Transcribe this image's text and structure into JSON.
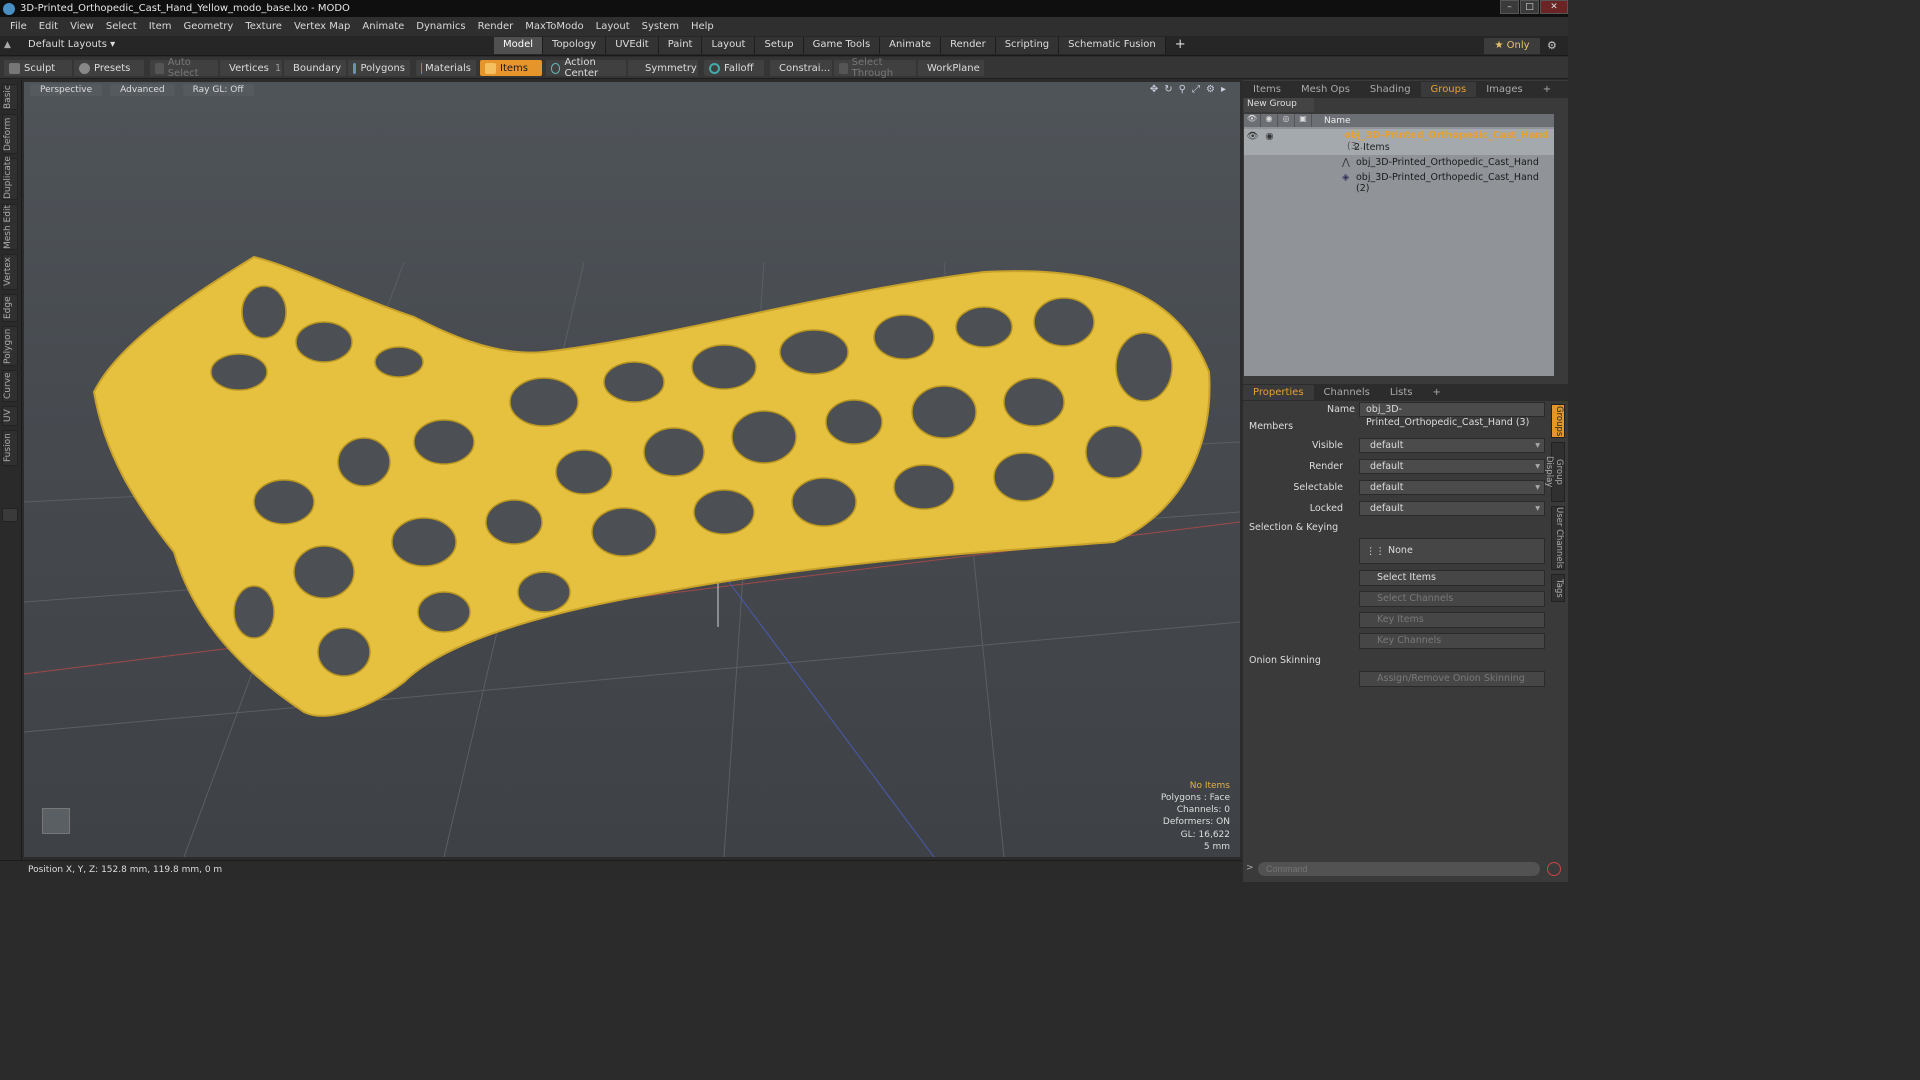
{
  "window": {
    "title": "3D-Printed_Orthopedic_Cast_Hand_Yellow_modo_base.lxo - MODO"
  },
  "menu": [
    "File",
    "Edit",
    "View",
    "Select",
    "Item",
    "Geometry",
    "Texture",
    "Vertex Map",
    "Animate",
    "Dynamics",
    "Render",
    "MaxToModo",
    "Layout",
    "System",
    "Help"
  ],
  "layout": {
    "default_layouts": "Default Layouts ▾",
    "tabs": [
      "Model",
      "Topology",
      "UVEdit",
      "Paint",
      "Layout",
      "Setup",
      "Game Tools",
      "Animate",
      "Render",
      "Scripting",
      "Schematic Fusion"
    ],
    "active_tab": "Model",
    "plus": "+",
    "only": "★ Only"
  },
  "toolbar": {
    "sculpt": "Sculpt",
    "presets": "Presets",
    "auto_select": "Auto Select",
    "vertices": "Vertices",
    "vertices_count": "1",
    "boundary": "Boundary",
    "polygons": "Polygons",
    "materials": "Materials",
    "items": "Items",
    "action_center": "Action Center",
    "symmetry": "Symmetry",
    "falloff": "Falloff",
    "constrain": "Constrai...",
    "select_through": "Select Through",
    "workplane": "WorkPlane"
  },
  "left_tabs": [
    "Basic",
    "Deform",
    "Duplicate",
    "Mesh Edit",
    "Vertex",
    "Edge",
    "Polygon",
    "Curve",
    "UV",
    "Fusion"
  ],
  "viewport": {
    "perspective": "Perspective",
    "advanced": "Advanced",
    "raygl": "Ray GL: Off",
    "info": {
      "no_items": "No Items",
      "polygons": "Polygons : Face",
      "channels": "Channels: 0",
      "deformers": "Deformers: ON",
      "gl": "GL: 16,622",
      "scale": "5 mm"
    },
    "colors": {
      "model": "#e6c140",
      "bg_top": "#4f5459",
      "bg_bottom": "#3e4246"
    }
  },
  "status": {
    "position": "Position X, Y, Z:  152.8 mm, 119.8 mm, 0 m"
  },
  "groups_panel": {
    "tabs": [
      "Items",
      "Mesh Ops",
      "Shading",
      "Groups",
      "Images",
      "+"
    ],
    "active_tab": "Groups",
    "new_group": "New Group",
    "name_header": "Name",
    "group_name": "obj_3D-Printed_Orthopedic_Cast_Hand",
    "group_suffix": "(3...",
    "group_count": "2 Items",
    "children": [
      "obj_3D-Printed_Orthopedic_Cast_Hand",
      "obj_3D-Printed_Orthopedic_Cast_Hand (2)"
    ]
  },
  "properties": {
    "tabs": [
      "Properties",
      "Channels",
      "Lists",
      "+"
    ],
    "active_tab": "Properties",
    "name_label": "Name",
    "name_value": "obj_3D-Printed_Orthopedic_Cast_Hand (3)",
    "members": "Members",
    "visible_label": "Visible",
    "visible_value": "default",
    "render_label": "Render",
    "render_value": "default",
    "selectable_label": "Selectable",
    "selectable_value": "default",
    "locked_label": "Locked",
    "locked_value": "default",
    "selection_keying": "Selection & Keying",
    "none": "None",
    "select_items": "Select Items",
    "select_channels": "Select Channels",
    "key_items": "Key Items",
    "key_channels": "Key Channels",
    "onion": "Onion Skinning",
    "assign_onion": "Assign/Remove Onion Skinning"
  },
  "right_vtabs": [
    "Groups",
    "Group Display",
    "User Channels",
    "Tags"
  ],
  "command": {
    "placeholder": "Command"
  }
}
